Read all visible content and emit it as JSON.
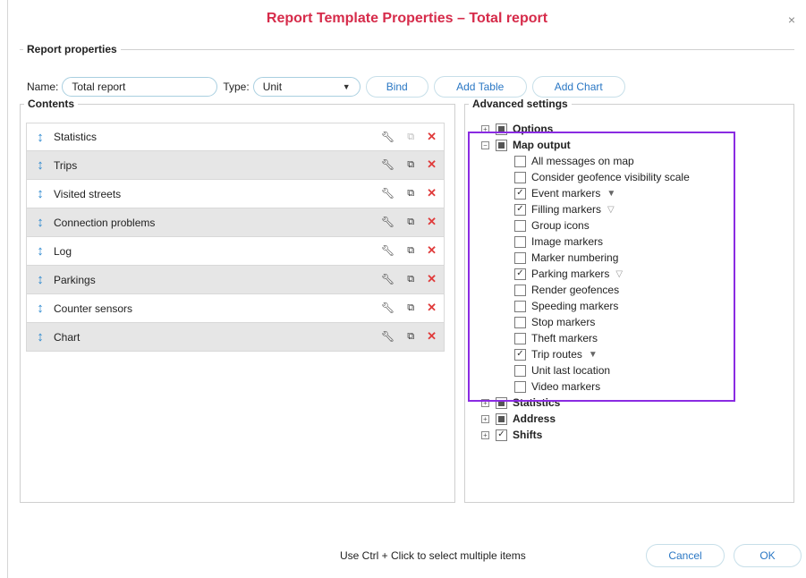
{
  "dialog": {
    "title": "Report Template Properties – Total report",
    "close_icon": "×"
  },
  "report_properties": {
    "legend": "Report properties",
    "name_label": "Name:",
    "name_value": "Total report",
    "type_label": "Type:",
    "type_value": "Unit",
    "buttons": [
      "Bind",
      "Add Table",
      "Add Chart"
    ]
  },
  "contents": {
    "legend": "Contents",
    "items": [
      {
        "label": "Statistics",
        "copy_enabled": false
      },
      {
        "label": "Trips",
        "copy_enabled": true
      },
      {
        "label": "Visited streets",
        "copy_enabled": true
      },
      {
        "label": "Connection problems",
        "copy_enabled": true
      },
      {
        "label": "Log",
        "copy_enabled": true
      },
      {
        "label": "Parkings",
        "copy_enabled": true
      },
      {
        "label": "Counter sensors",
        "copy_enabled": true
      },
      {
        "label": "Chart",
        "copy_enabled": true
      }
    ]
  },
  "advanced": {
    "legend": "Advanced settings",
    "options": {
      "label": "Options",
      "state": "partial",
      "expanded": false
    },
    "map_output": {
      "label": "Map output",
      "state": "partial",
      "expanded": true,
      "children": [
        {
          "label": "All messages on map",
          "checked": false,
          "filter": ""
        },
        {
          "label": "Consider geofence visibility scale",
          "checked": false,
          "filter": ""
        },
        {
          "label": "Event markers",
          "checked": true,
          "filter": "filled"
        },
        {
          "label": "Filling markers",
          "checked": true,
          "filter": "outline"
        },
        {
          "label": "Group icons",
          "checked": false,
          "filter": ""
        },
        {
          "label": "Image markers",
          "checked": false,
          "filter": ""
        },
        {
          "label": "Marker numbering",
          "checked": false,
          "filter": ""
        },
        {
          "label": "Parking markers",
          "checked": true,
          "filter": "outline"
        },
        {
          "label": "Render geofences",
          "checked": false,
          "filter": ""
        },
        {
          "label": "Speeding markers",
          "checked": false,
          "filter": ""
        },
        {
          "label": "Stop markers",
          "checked": false,
          "filter": ""
        },
        {
          "label": "Theft markers",
          "checked": false,
          "filter": ""
        },
        {
          "label": "Trip routes",
          "checked": true,
          "filter": "filled"
        },
        {
          "label": "Unit last location",
          "checked": false,
          "filter": ""
        },
        {
          "label": "Video markers",
          "checked": false,
          "filter": ""
        }
      ]
    },
    "statistics": {
      "label": "Statistics",
      "state": "partial",
      "expanded": false
    },
    "address": {
      "label": "Address",
      "state": "partial",
      "expanded": false
    },
    "shifts": {
      "label": "Shifts",
      "state": "checked",
      "expanded": false
    }
  },
  "footer": {
    "hint": "Use Ctrl + Click to select multiple items",
    "cancel_label": "Cancel",
    "ok_label": "OK"
  },
  "colors": {
    "title": "#d62b4a",
    "accent": "#2a77c4",
    "highlight": "#8a2be2",
    "delete": "#e03b3b"
  }
}
